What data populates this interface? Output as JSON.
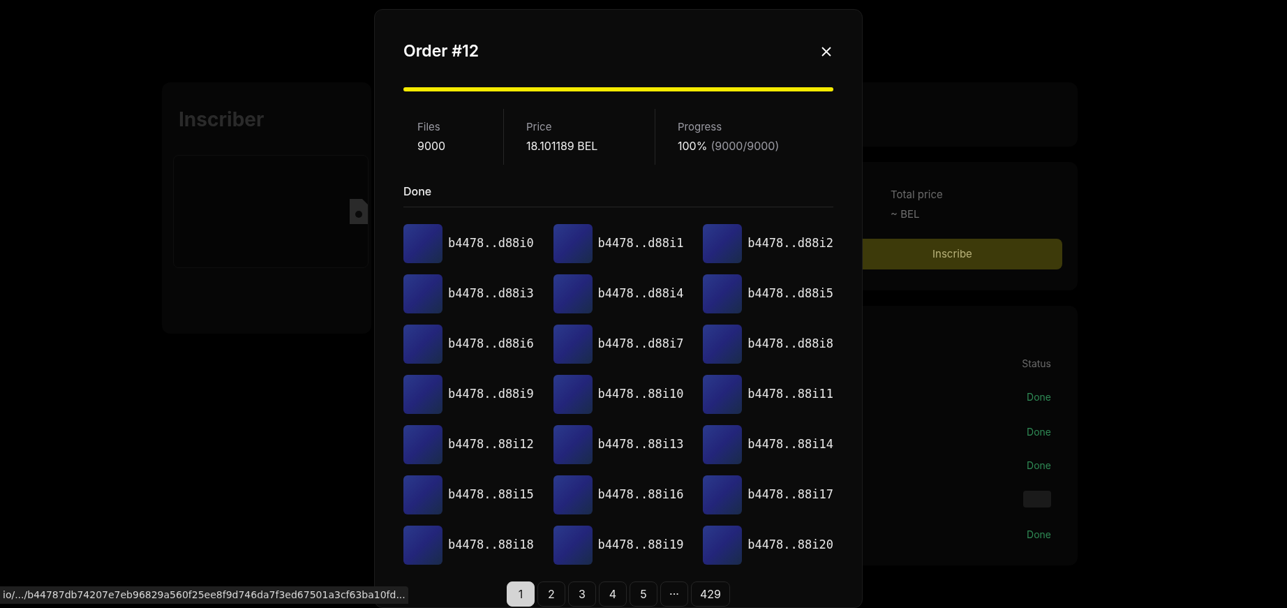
{
  "background": {
    "page_title": "Inscriber",
    "total_price_label": "Total price",
    "total_price_value": "~ BEL",
    "inscribe_button": "Inscribe",
    "status_header": "Status",
    "statuses": [
      "Done",
      "Done",
      "Done",
      "Done"
    ]
  },
  "modal": {
    "title": "Order #12",
    "progress": {
      "level": 1
    },
    "stats": [
      {
        "label": "Files",
        "value": "9000"
      },
      {
        "label": "Price",
        "value": "18.101189 BEL"
      },
      {
        "label": "Progress",
        "value": "100%",
        "detail": "(9000/9000)"
      }
    ],
    "section_title": "Done",
    "files": [
      "b4478..d88i0",
      "b4478..d88i1",
      "b4478..d88i2",
      "b4478..d88i3",
      "b4478..d88i4",
      "b4478..d88i5",
      "b4478..d88i6",
      "b4478..d88i7",
      "b4478..d88i8",
      "b4478..d88i9",
      "b4478..88i10",
      "b4478..88i11",
      "b4478..88i12",
      "b4478..88i13",
      "b4478..88i14",
      "b4478..88i15",
      "b4478..88i16",
      "b4478..88i17",
      "b4478..88i18",
      "b4478..88i19",
      "b4478..88i20"
    ],
    "pagination": [
      {
        "label": "1",
        "selected": true
      },
      {
        "label": "2",
        "selected": false
      },
      {
        "label": "3",
        "selected": false
      },
      {
        "label": "4",
        "selected": false
      },
      {
        "label": "5",
        "selected": false
      },
      {
        "label": "···",
        "selected": false
      },
      {
        "label": "429",
        "selected": false
      }
    ]
  },
  "status_url": "io/.../b44787db74207e7eb96829a560f25ee8f9d746da7f3ed67501a3cf63ba10fd..."
}
